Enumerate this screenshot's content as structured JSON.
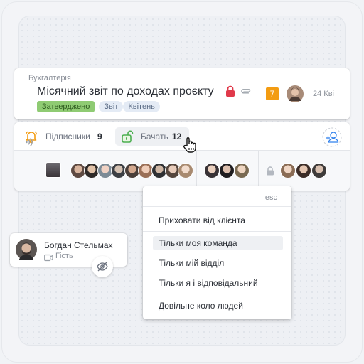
{
  "task": {
    "project": "Бухгалтерія",
    "title": "Місячний звіт по доходах проєкту",
    "tags": [
      "Затверджено",
      "Звіт",
      "Квітень"
    ],
    "comments_count": "7",
    "date": "24 Кві",
    "icons": [
      "lock-icon",
      "paperclip-icon",
      "avatar"
    ]
  },
  "watchers": {
    "subscribers_label": "Підписники",
    "subscribers_count": "9",
    "seeing_label": "Бачать",
    "seeing_count": "12",
    "icons": [
      "bell-icon",
      "unlock-icon",
      "add-user-icon",
      "sound-icon",
      "lock-icon"
    ]
  },
  "menu": {
    "esc": "esc",
    "items": [
      "Приховати від клієнта",
      "Тільки моя команда",
      "Тільки мій відділ",
      "Тільки я і відповідальний",
      "Довільне коло людей"
    ]
  },
  "guest": {
    "name": "Богдан Стельмах",
    "role": "Гість"
  },
  "colors": {
    "approved_tag": "#8fcb73",
    "badge": "#f39c12",
    "bell": "#f39c12",
    "unlock": "#4caf50",
    "lock_red": "#e0394a",
    "add_user": "#2f80ed"
  }
}
